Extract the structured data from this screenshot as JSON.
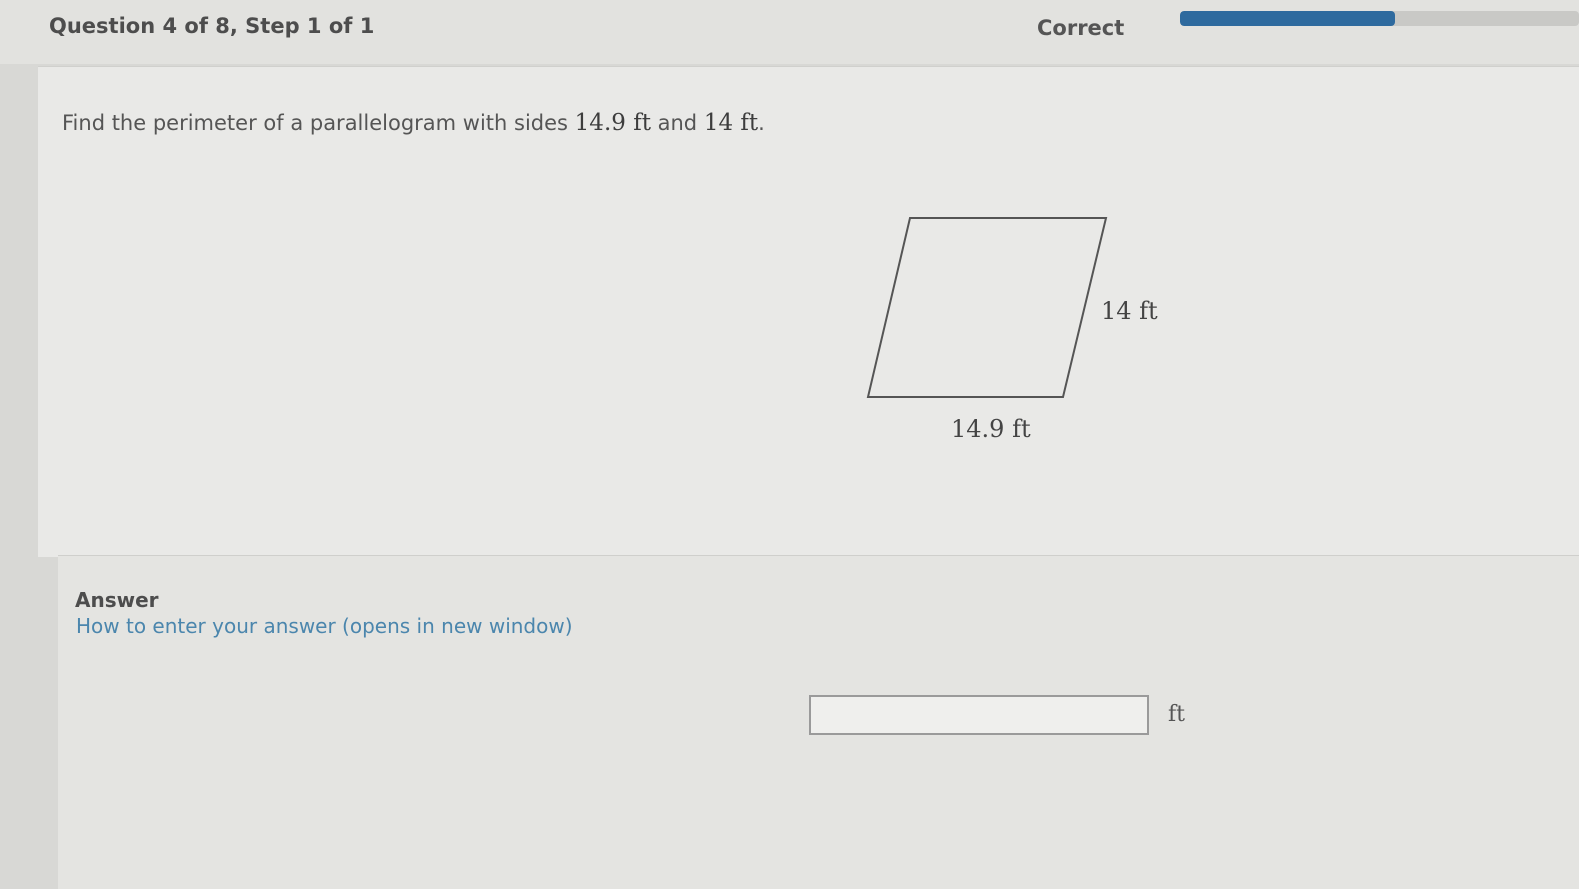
{
  "header": {
    "question_title": "Question 4 of 8, Step 1 of 1",
    "status_label": "Correct",
    "progress_fraction": 0.54,
    "progress_color": "#2e6a9e"
  },
  "question": {
    "prompt_prefix": "Find the perimeter of a parallelogram with sides ",
    "side_a": "14.9 ft",
    "conjunction": " and ",
    "side_b": "14 ft",
    "prompt_suffix": "."
  },
  "figure": {
    "side_label_right": "14 ft",
    "side_label_bottom": "14.9 ft"
  },
  "answer": {
    "heading": "Answer",
    "help_link": "How to enter your answer (opens in new window)",
    "input_value": "",
    "unit": "ft"
  }
}
